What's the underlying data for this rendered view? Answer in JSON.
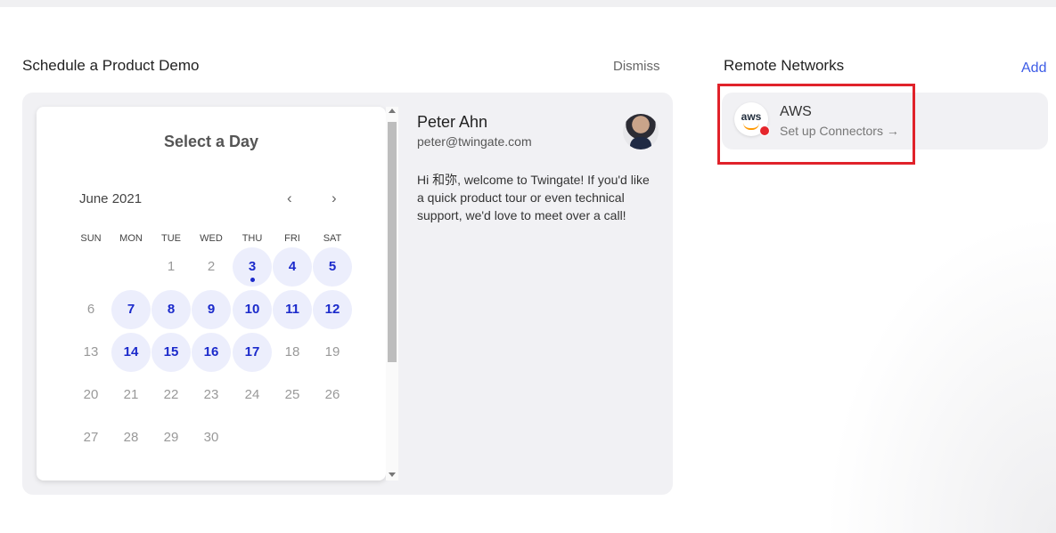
{
  "demo": {
    "title": "Schedule a Product Demo",
    "dismiss_label": "Dismiss",
    "calendar": {
      "title": "Select a Day",
      "month": "June 2021",
      "prev_icon": "chevron-left-icon",
      "next_icon": "chevron-right-icon",
      "prev_glyph": "‹",
      "next_glyph": "›",
      "weekdays": [
        "SUN",
        "MON",
        "TUE",
        "WED",
        "THU",
        "FRI",
        "SAT"
      ],
      "weeks": [
        [
          null,
          null,
          "1",
          "2",
          "3",
          "4",
          "5"
        ],
        [
          "6",
          "7",
          "8",
          "9",
          "10",
          "11",
          "12"
        ],
        [
          "13",
          "14",
          "15",
          "16",
          "17",
          "18",
          "19"
        ],
        [
          "20",
          "21",
          "22",
          "23",
          "24",
          "25",
          "26"
        ],
        [
          "27",
          "28",
          "29",
          "30",
          null,
          null,
          null
        ]
      ],
      "available": [
        "3",
        "4",
        "5",
        "7",
        "8",
        "9",
        "10",
        "11",
        "12",
        "14",
        "15",
        "16",
        "17"
      ],
      "today": "3",
      "accent_color": "#1b2acb"
    },
    "host": {
      "name": "Peter Ahn",
      "email": "peter@twingate.com",
      "message": "Hi 和弥, welcome to Twingate! If you'd like a quick product tour or even technical support, we'd love to meet over a call!"
    }
  },
  "remote_networks": {
    "title": "Remote Networks",
    "add_label": "Add",
    "items": [
      {
        "logo_text": "aws",
        "name": "AWS",
        "subtitle": "Set up Connectors →",
        "status_color": "#e5262c"
      }
    ]
  }
}
